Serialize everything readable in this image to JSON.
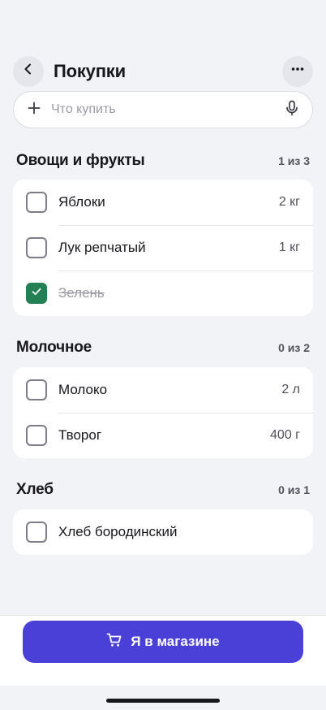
{
  "header": {
    "title": "Покупки",
    "back_icon": "chevron-left-icon",
    "more_icon": "more-horizontal-icon"
  },
  "search": {
    "placeholder": "Что купить",
    "value": "",
    "add_icon": "plus-icon",
    "mic_icon": "microphone-icon"
  },
  "sections": [
    {
      "title": "Овощи и фрукты",
      "count": "1 из 3",
      "items": [
        {
          "name": "Яблоки",
          "qty": "2 кг",
          "checked": false
        },
        {
          "name": "Лук репчатый",
          "qty": "1 кг",
          "checked": false
        },
        {
          "name": "Зелень",
          "qty": "",
          "checked": true
        }
      ]
    },
    {
      "title": "Молочное",
      "count": "0 из 2",
      "items": [
        {
          "name": "Молоко",
          "qty": "2 л",
          "checked": false
        },
        {
          "name": "Творог",
          "qty": "400 г",
          "checked": false
        }
      ]
    },
    {
      "title": "Хлеб",
      "count": "0 из 1",
      "items": [
        {
          "name": "Хлеб бородинский",
          "qty": "",
          "checked": false
        }
      ]
    }
  ],
  "footer": {
    "button_label": "Я в магазине",
    "button_icon": "shopping-cart-icon"
  },
  "colors": {
    "accent": "#4a3fd6",
    "checked": "#238055",
    "background": "#f2f3f7"
  }
}
